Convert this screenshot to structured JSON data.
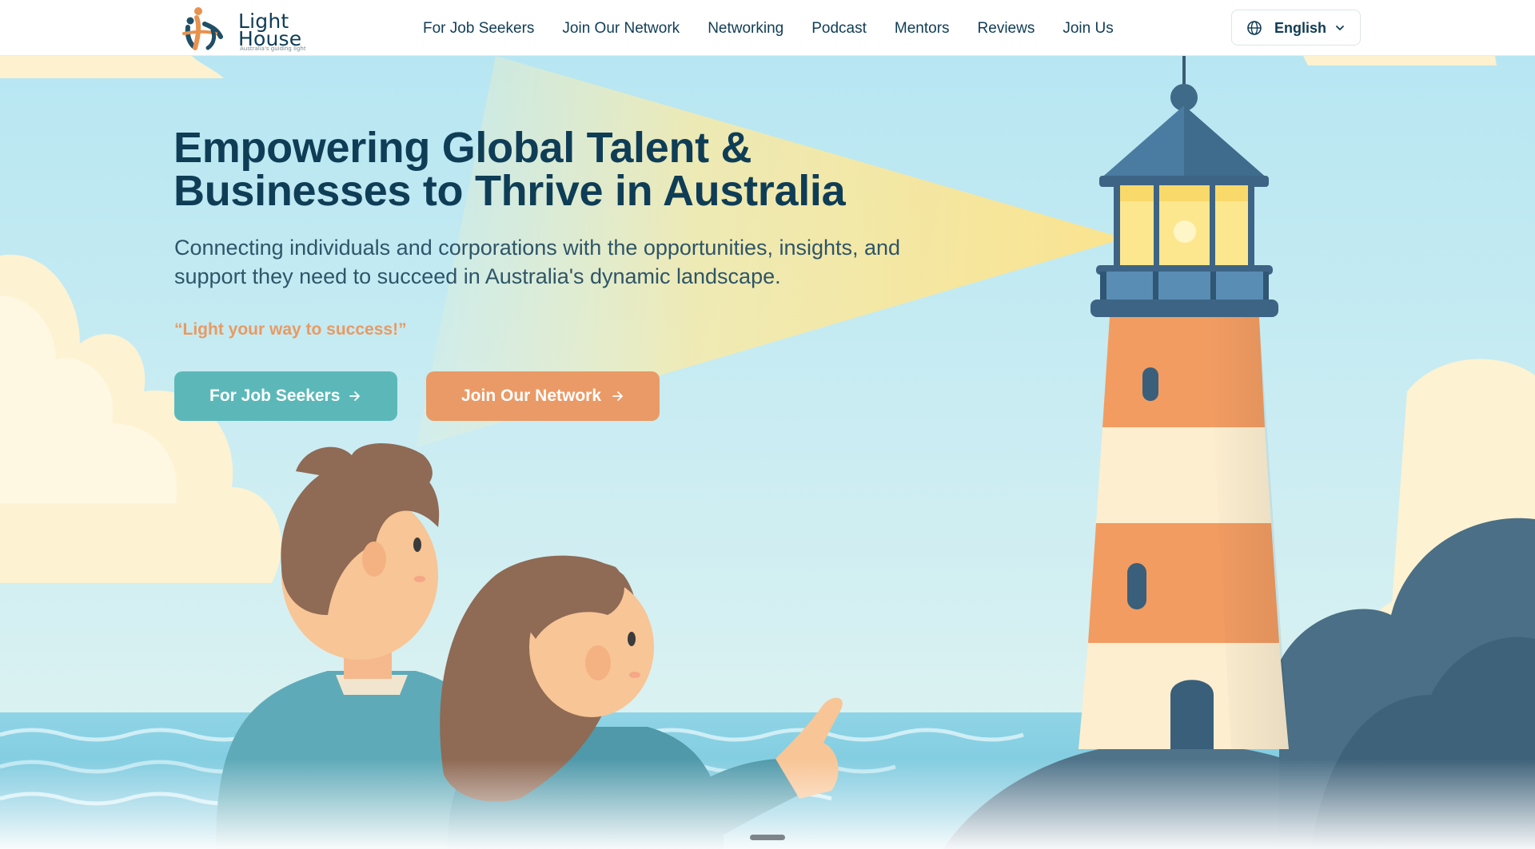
{
  "brand": {
    "name_line1": "Light",
    "name_line2": "House",
    "tagline": "Australia's guiding light"
  },
  "nav": {
    "items": [
      {
        "label": "For Job Seekers"
      },
      {
        "label": "Join Our Network"
      },
      {
        "label": "Networking"
      },
      {
        "label": "Podcast"
      },
      {
        "label": "Mentors"
      },
      {
        "label": "Reviews"
      },
      {
        "label": "Join Us"
      }
    ]
  },
  "language": {
    "selected": "English",
    "icon": "globe-icon"
  },
  "hero": {
    "title_line1": "Empowering Global Talent &",
    "title_line2": "Businesses to Thrive in Australia",
    "subtitle_line1": "Connecting individuals and corporations with the opportunities, insights, and",
    "subtitle_line2": "support they need to succeed in Australia's dynamic landscape.",
    "quote": "“Light your way to success!”",
    "cta_primary": "For Job Seekers",
    "cta_secondary": "Join Our Network"
  },
  "colors": {
    "navy": "#0f3d56",
    "teal": "#5cb8b8",
    "orange": "#ea9a66",
    "quote_orange": "#e89a62",
    "sky": "#bfe6f0"
  }
}
